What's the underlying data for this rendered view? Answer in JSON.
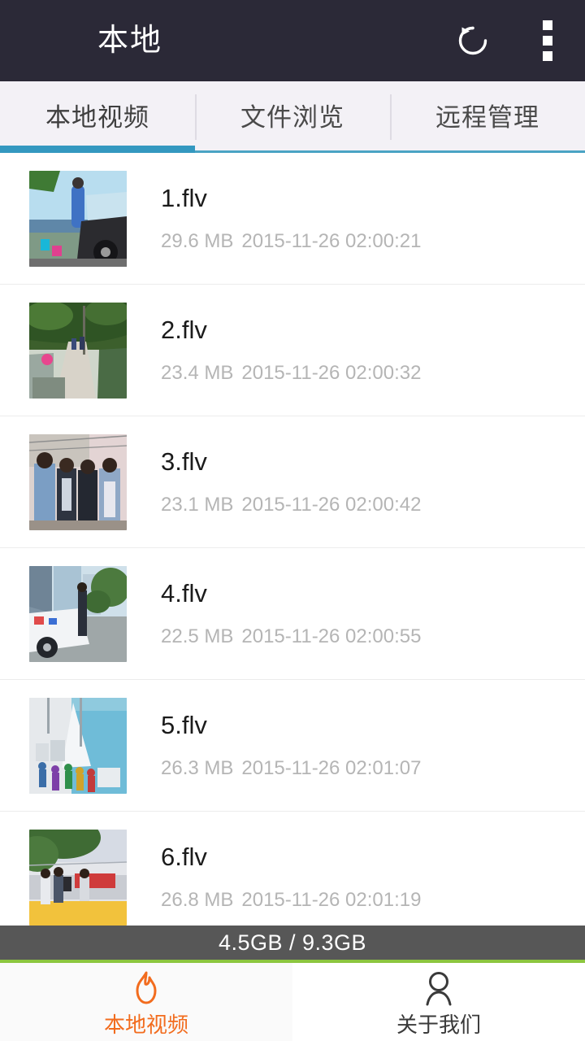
{
  "header": {
    "title": "本地",
    "refresh_icon": "refresh-icon",
    "overflow_icon": "overflow-menu-icon",
    "background_color": "#2b2937"
  },
  "tabs": {
    "active_index": 0,
    "accent_color": "#3498c0",
    "items": [
      {
        "label": "本地视频"
      },
      {
        "label": "文件浏览"
      },
      {
        "label": "远程管理"
      }
    ]
  },
  "file_list": [
    {
      "name": "1.flv",
      "size": "29.6 MB",
      "date": "2015-11-26 02:00:21",
      "thumbnail": "video-thumbnail-man-blue-coat-car"
    },
    {
      "name": "2.flv",
      "size": "23.4 MB",
      "date": "2015-11-26 02:00:32",
      "thumbnail": "video-thumbnail-village-path-trees"
    },
    {
      "name": "3.flv",
      "size": "23.1 MB",
      "date": "2015-11-26 02:00:42",
      "thumbnail": "video-thumbnail-four-men-wall"
    },
    {
      "name": "4.flv",
      "size": "22.5 MB",
      "date": "2015-11-26 02:00:55",
      "thumbnail": "video-thumbnail-city-street-white-car"
    },
    {
      "name": "5.flv",
      "size": "26.3 MB",
      "date": "2015-11-26 02:01:07",
      "thumbnail": "video-thumbnail-waterfront-crowd-boats"
    },
    {
      "name": "6.flv",
      "size": "26.8 MB",
      "date": "2015-11-26 02:01:19",
      "thumbnail": "video-thumbnail-outdoor-cafe-yellow"
    }
  ],
  "storage": {
    "text": "4.5GB / 9.3GB",
    "used": "4.5GB",
    "total": "9.3GB",
    "bar_color": "#575757",
    "accent_color": "#8cc63f"
  },
  "bottom_nav": {
    "active_index": 0,
    "active_color": "#f26c1e",
    "items": [
      {
        "label": "本地视频",
        "icon": "flame-icon"
      },
      {
        "label": "关于我们",
        "icon": "person-icon"
      }
    ]
  }
}
